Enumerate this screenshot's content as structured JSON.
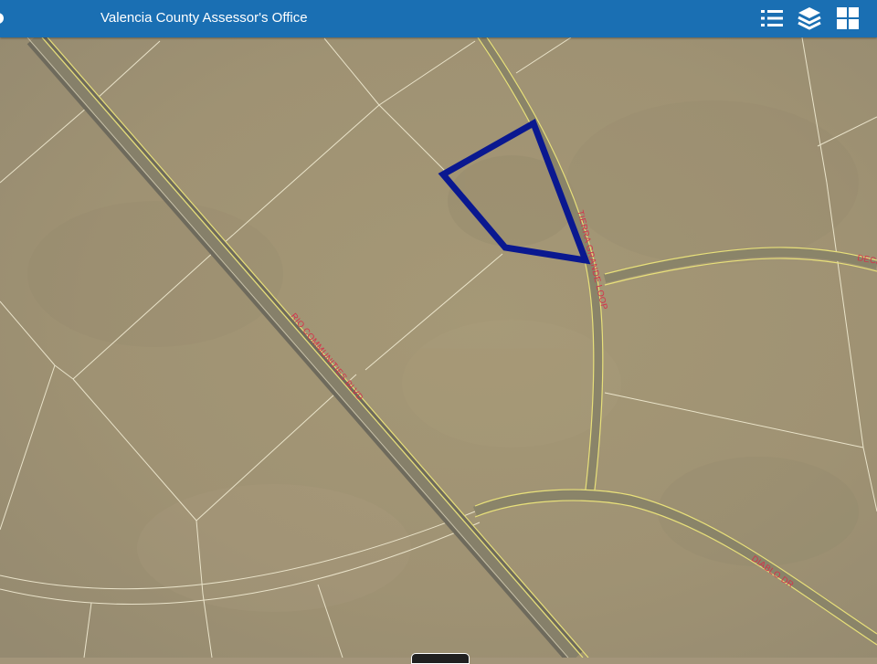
{
  "header": {
    "title": "Valencia County Assessor's Office",
    "bg_color": "#1a6fb3",
    "tools": [
      {
        "name": "legend-list-icon",
        "icon": "list"
      },
      {
        "name": "layers-icon",
        "icon": "layers"
      },
      {
        "name": "basemap-gallery-icon",
        "icon": "grid"
      }
    ]
  },
  "map": {
    "basemap": "satellite imagery",
    "roads": {
      "rio_communities": "RIO COMMUNITIES BLVD",
      "tierra_grande": "TIERRA GRANDE LOOP",
      "diablo": "DIABLO DR",
      "decatur_partial": "DECA"
    },
    "highlight_color": "#0a1890",
    "parcel_line_color": "#f4eed6",
    "road_color": "#e8e07a"
  }
}
